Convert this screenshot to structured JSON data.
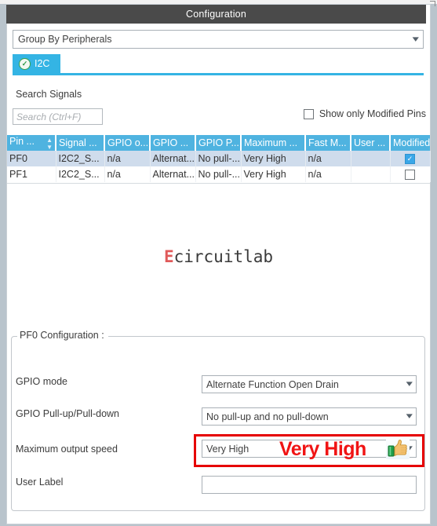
{
  "window": {
    "title": "Configuration"
  },
  "groupby": {
    "selected": "Group By Peripherals",
    "caret": "chevron-down-icon"
  },
  "tabs": [
    {
      "label": "I2C",
      "status_icon": "check-circle-icon",
      "active": true
    }
  ],
  "search": {
    "label": "Search Signals",
    "placeholder": "Search (Ctrl+F)",
    "value": ""
  },
  "filters": {
    "show_only_modified_label": "Show only Modified Pins",
    "show_only_modified_checked": false
  },
  "table": {
    "columns": [
      {
        "label": "Pin ...",
        "sortable": true
      },
      {
        "label": "Signal ...",
        "sortable": false
      },
      {
        "label": "GPIO o...",
        "sortable": false
      },
      {
        "label": "GPIO ...",
        "sortable": false
      },
      {
        "label": "GPIO P...",
        "sortable": false
      },
      {
        "label": "Maximum ...",
        "sortable": false
      },
      {
        "label": "Fast M...",
        "sortable": false
      },
      {
        "label": "User ...",
        "sortable": false
      },
      {
        "label": "Modified",
        "sortable": false
      }
    ],
    "rows": [
      {
        "pin": "PF0",
        "signal": "I2C2_S...",
        "gpio_output": "n/a",
        "gpio_mode": "Alternat...",
        "gpio_pull": "No pull-...",
        "maximum_speed": "Very High",
        "fast_mode": "n/a",
        "user_label": "",
        "modified": true,
        "selected": true
      },
      {
        "pin": "PF1",
        "signal": "I2C2_S...",
        "gpio_output": "n/a",
        "gpio_mode": "Alternat...",
        "gpio_pull": "No pull-...",
        "maximum_speed": "Very High",
        "fast_mode": "n/a",
        "user_label": "",
        "modified": false,
        "selected": false
      }
    ]
  },
  "watermark": {
    "prefix": "E",
    "rest": "circuitlab",
    "accent_color": "#e05a5a"
  },
  "config_panel": {
    "title": "PF0 Configuration :",
    "fields": [
      {
        "label": "GPIO mode",
        "value": "Alternate Function Open Drain",
        "type": "select"
      },
      {
        "label": "GPIO Pull-up/Pull-down",
        "value": "No pull-up and no pull-down",
        "type": "select"
      },
      {
        "label": "Maximum output speed",
        "value": "Very High",
        "type": "select"
      },
      {
        "label": "User Label",
        "value": "",
        "type": "text"
      }
    ]
  },
  "annotation": {
    "text": "Very High",
    "color": "#f01414",
    "icon": "thumbs-up-icon",
    "highlight_color": "#e60000"
  }
}
